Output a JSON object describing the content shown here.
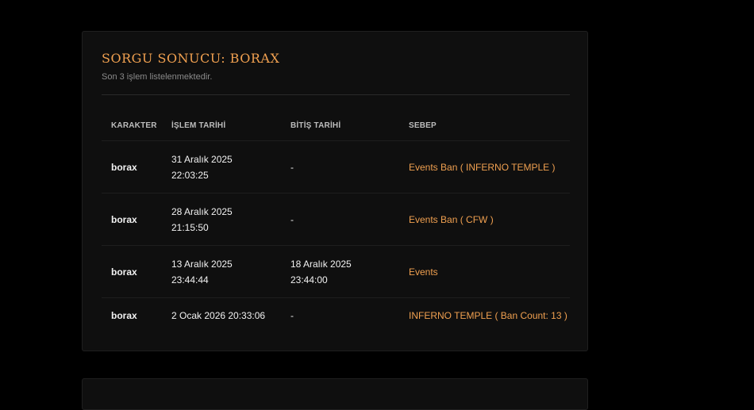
{
  "header": {
    "title": "SORGU SONUCU: BORAX",
    "subtitle": "Son 3 işlem listelenmektedir."
  },
  "table": {
    "columns": [
      "KARAKTER",
      "İŞLEM TARİHİ",
      "BİTİŞ TARİHİ",
      "SEBEP"
    ],
    "rows": [
      {
        "character": "borax",
        "date_line1": "31 Aralık 2025",
        "date_line2": "22:03:25",
        "end_line1": "-",
        "end_line2": "",
        "reason": "Events Ban ( INFERNO TEMPLE )"
      },
      {
        "character": "borax",
        "date_line1": "28 Aralık 2025",
        "date_line2": "21:15:50",
        "end_line1": "-",
        "end_line2": "",
        "reason": "Events Ban ( CFW )"
      },
      {
        "character": "borax",
        "date_line1": "13 Aralık 2025",
        "date_line2": "23:44:44",
        "end_line1": "18 Aralık 2025",
        "end_line2": "23:44:00",
        "reason": "Events"
      },
      {
        "character": "borax",
        "date_line1": "2 Ocak 2026 20:33:06",
        "date_line2": "",
        "end_line1": "-",
        "end_line2": "",
        "reason": "INFERNO TEMPLE ( Ban Count: 13 )"
      }
    ]
  },
  "colors": {
    "accent": "#f0a050",
    "background": "#000000",
    "card": "#0f0f0f"
  }
}
